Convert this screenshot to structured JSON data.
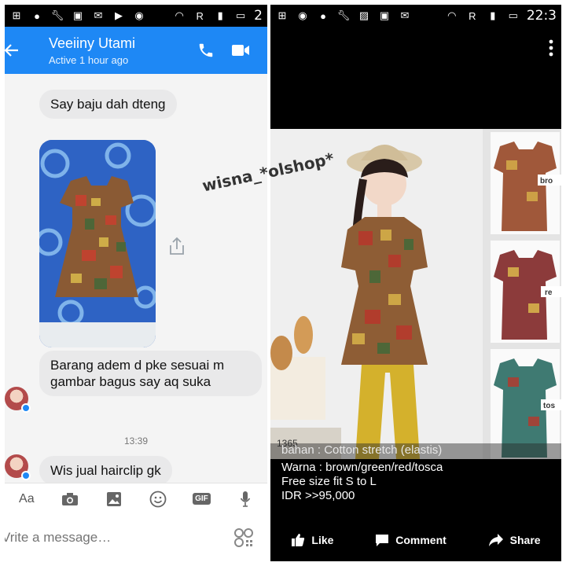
{
  "left": {
    "status_time": "2",
    "header": {
      "name": "Veeiiny Utami",
      "status": "Active 1 hour ago"
    },
    "messages": [
      {
        "text": "Say baju dah dteng"
      },
      {
        "text": "Barang adem d pke sesuai m gambar bagus say aq suka"
      },
      {
        "text": "Wis jual hairclip gk"
      }
    ],
    "timestamp": "13:39",
    "composer": {
      "placeholder": "Vrite a message…",
      "aa_label": "Aa",
      "gif_label": "GIF"
    },
    "watermark": "wisna_*olshop*"
  },
  "right": {
    "status_time": "22:3",
    "caption": "bahan : Cotton stretch (elastis)",
    "details": [
      "Warna : brown/green/red/tosca",
      "Free size fit S to L",
      "IDR >>95,000"
    ],
    "image_labels": {
      "sign": "1365",
      "tag1": "bro",
      "tag2": "re",
      "tag3": "tos"
    },
    "actions": {
      "like": "Like",
      "comment": "Comment",
      "share": "Share"
    }
  },
  "colors": {
    "messenger_blue": "#1e88f5",
    "bubble_gray": "#e9e9ea",
    "mustard": "#d4b12c"
  }
}
